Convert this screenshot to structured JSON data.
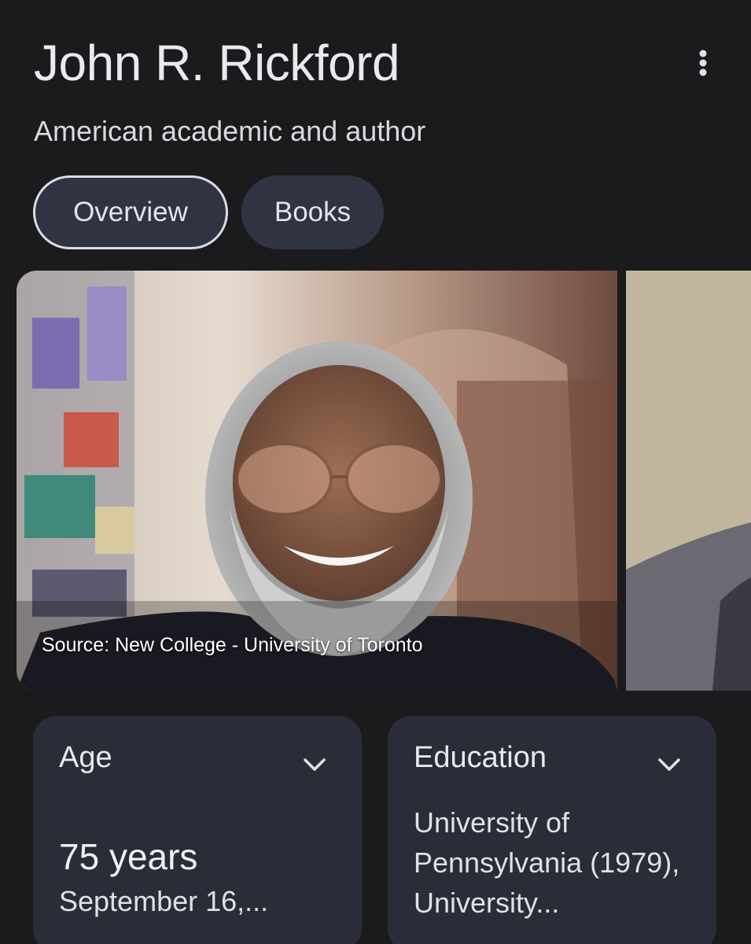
{
  "header": {
    "title": "John R. Rickford",
    "subtitle": "American academic and author",
    "more_icon": "more-vert-icon"
  },
  "tabs": [
    {
      "label": "Overview",
      "active": true
    },
    {
      "label": "Books",
      "active": false
    }
  ],
  "images": {
    "main_source": "Source: New College - University of Toronto"
  },
  "cards": {
    "age": {
      "label": "Age",
      "value": "75 years",
      "detail": "September 16,..."
    },
    "education": {
      "label": "Education",
      "text": "University of Pennsylvania (1979), University..."
    }
  },
  "colors": {
    "background": "#1b1b1d",
    "card": "#2a2d38",
    "chip": "#303442"
  }
}
